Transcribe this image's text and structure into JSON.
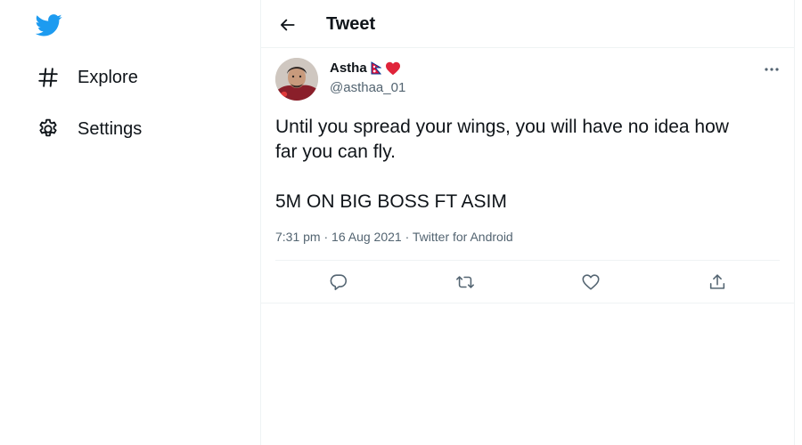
{
  "sidebar": {
    "logo_icon": "twitter-bird-icon",
    "brand_color": "#1d9bf0",
    "items": [
      {
        "label": "Explore",
        "icon": "hashtag-icon"
      },
      {
        "label": "Settings",
        "icon": "gear-icon"
      }
    ]
  },
  "header": {
    "title": "Tweet",
    "back_icon": "back-arrow-icon"
  },
  "tweet": {
    "author_name": "Astha",
    "author_emoji": [
      "nepal-flag-icon",
      "red-heart-icon"
    ],
    "author_handle": "@asthaa_01",
    "text_lines": [
      "Until you spread your wings, you will have no idea how",
      "far you can fly.",
      "5M ON BIG BOSS FT ASIM"
    ],
    "time": "7:31 pm",
    "date": "16 Aug 2021",
    "source": "Twitter for Android",
    "separator": " · ",
    "actions": [
      "reply-icon",
      "retweet-icon",
      "like-icon",
      "share-icon"
    ]
  },
  "colors": {
    "text_primary": "#0f1419",
    "text_secondary": "#536471",
    "border": "#eff3f4"
  }
}
